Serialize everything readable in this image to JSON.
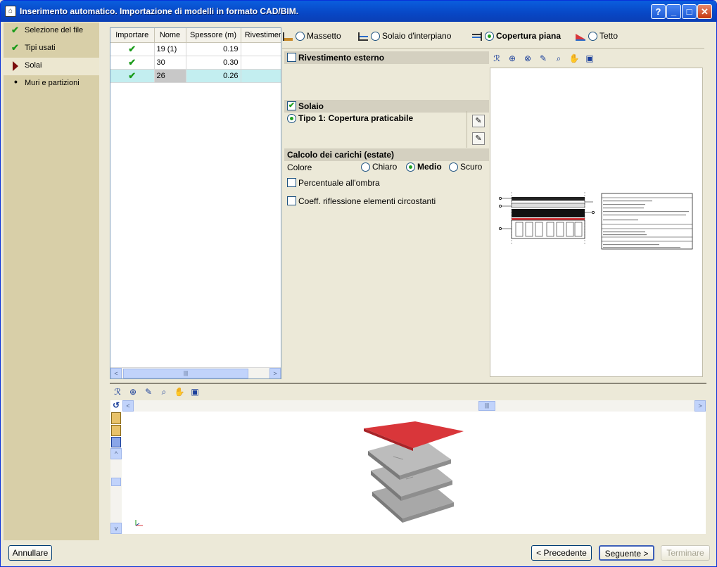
{
  "window": {
    "title": "Inserimento automatico. Importazione di modelli in formato CAD/BIM.",
    "help_label": "?",
    "minimize_label": "_",
    "maximize_label": "□",
    "close_label": "✕"
  },
  "sidebar": {
    "items": [
      {
        "label": "Selezione del file",
        "state": "done"
      },
      {
        "label": "Tipi usati",
        "state": "done"
      },
      {
        "label": "Solai",
        "state": "current"
      },
      {
        "label": "Muri e partizioni",
        "state": "pending"
      }
    ]
  },
  "grid": {
    "headers": [
      "Importare",
      "Nome",
      "Spessore (m)",
      "Rivestimento"
    ],
    "rows": [
      {
        "import": "✔",
        "name": "19 (1)",
        "thickness": "0.19",
        "cover": ""
      },
      {
        "import": "✔",
        "name": "30",
        "thickness": "0.30",
        "cover": ""
      },
      {
        "import": "✔",
        "name": "26",
        "thickness": "0.26",
        "cover": ""
      }
    ],
    "scroll_left": "<",
    "scroll_right": ">",
    "scroll_grip": "|||"
  },
  "types": {
    "options": [
      {
        "label": "Massetto",
        "selected": false
      },
      {
        "label": "Solaio d'interpiano",
        "selected": false
      },
      {
        "label": "Copertura piana",
        "selected": true
      },
      {
        "label": "Tetto",
        "selected": false
      }
    ]
  },
  "rivestimento": {
    "title": "Rivestimento esterno",
    "checked": false
  },
  "solaio": {
    "title": "Solaio",
    "checked": true,
    "type_label": "Tipo 1: Copertura praticabile",
    "edit1": "✎",
    "edit2": "✎"
  },
  "carichi": {
    "title": "Calcolo dei carichi (estate)",
    "colore_label": "Colore",
    "colors": [
      {
        "label": "Chiaro",
        "selected": false
      },
      {
        "label": "Medio",
        "selected": true
      },
      {
        "label": "Scuro",
        "selected": false
      }
    ],
    "ombra_label": "Percentuale all'ombra",
    "coeff_label": "Coeff. riflessione elementi circostanti"
  },
  "view3d": {
    "axis_label": "⊥",
    "up": "^",
    "down": "v",
    "left": "<",
    "right": ">",
    "grip": "|||"
  },
  "footer": {
    "cancel": "Annullare",
    "prev": "< Precedente",
    "next": "Seguente >",
    "finish": "Terminare"
  },
  "colors": {
    "titlebar": "#0a5ede",
    "check_green": "#1a9b1a",
    "roof_red": "#d9363a",
    "slab_gray": "#c8c8c8",
    "selection": "#c3eef0"
  }
}
